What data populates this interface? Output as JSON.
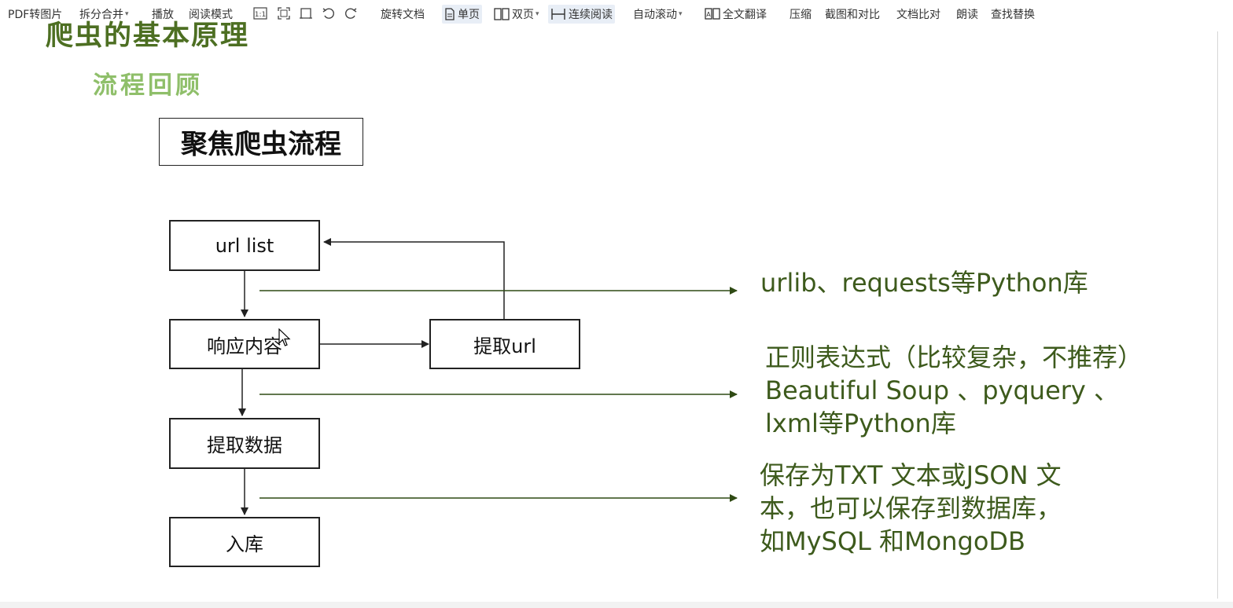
{
  "toolbar": {
    "pdf_to_image": "PDF转图片",
    "split_merge": "拆分合并",
    "play": "播放",
    "reading_mode": "阅读模式",
    "rotate_doc": "旋转文档",
    "single_page": "单页",
    "double_page": "双页",
    "continuous_reading": "连续阅读",
    "auto_scroll": "自动滚动",
    "full_translate": "全文翻译",
    "compress": "压缩",
    "screenshot_compare": "截图和对比",
    "doc_compare": "文档比对",
    "read_aloud": "朗读",
    "find_replace": "查找替换"
  },
  "slide": {
    "heading": "爬虫的基本原理",
    "subheading": "流程回顾",
    "title": "聚焦爬虫流程",
    "nodes": {
      "url_list": "url list",
      "response": "响应内容",
      "extract_url": "提取url",
      "extract_data": "提取数据",
      "storage": "入库"
    },
    "notes": {
      "fetch": "urlib、requests等Python库",
      "parse_line1": "正则表达式（比较复杂，不推荐）",
      "parse_line2": "Beautiful Soup 、pyquery 、",
      "parse_line3": "lxml等Python库",
      "save_line1": "保存为TXT 文本或JSON 文",
      "save_line2": "本，也可以保存到数据库，",
      "save_line3": "如MySQL 和MongoDB"
    }
  },
  "colors": {
    "heading": "#4d6f22",
    "subheading": "#8fbf6a",
    "note_text": "#3d5a1c",
    "arrow": "#2f4a14"
  }
}
